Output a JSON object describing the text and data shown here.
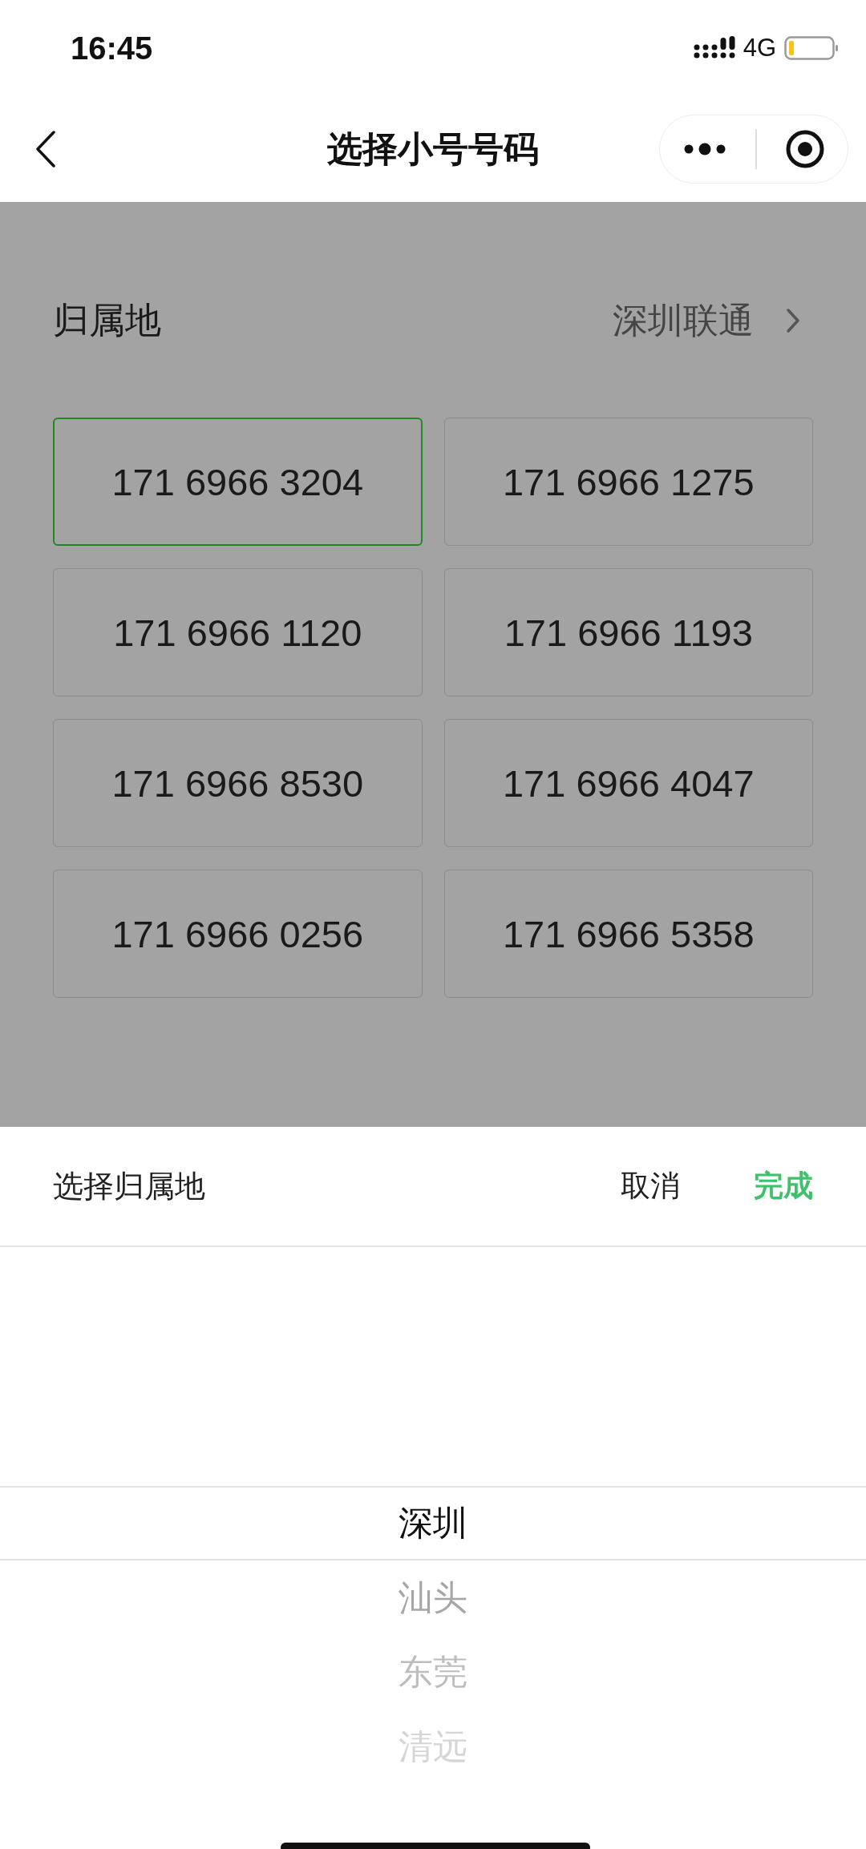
{
  "status_bar": {
    "time": "16:45",
    "network": "4G"
  },
  "nav": {
    "title": "选择小号号码"
  },
  "region": {
    "label": "归属地",
    "value": "深圳联通"
  },
  "numbers": [
    {
      "number": "171 6966 3204",
      "selected": true
    },
    {
      "number": "171 6966 1275",
      "selected": false
    },
    {
      "number": "171 6966 1120",
      "selected": false
    },
    {
      "number": "171 6966 1193",
      "selected": false
    },
    {
      "number": "171 6966 8530",
      "selected": false
    },
    {
      "number": "171 6966 4047",
      "selected": false
    },
    {
      "number": "171 6966 0256",
      "selected": false
    },
    {
      "number": "171 6966 5358",
      "selected": false
    }
  ],
  "sheet": {
    "title": "选择归属地",
    "cancel": "取消",
    "confirm": "完成",
    "options": [
      {
        "label": "深圳",
        "selected": true
      },
      {
        "label": "汕头",
        "selected": false
      },
      {
        "label": "东莞",
        "selected": false
      },
      {
        "label": "清远",
        "selected": false
      }
    ]
  }
}
